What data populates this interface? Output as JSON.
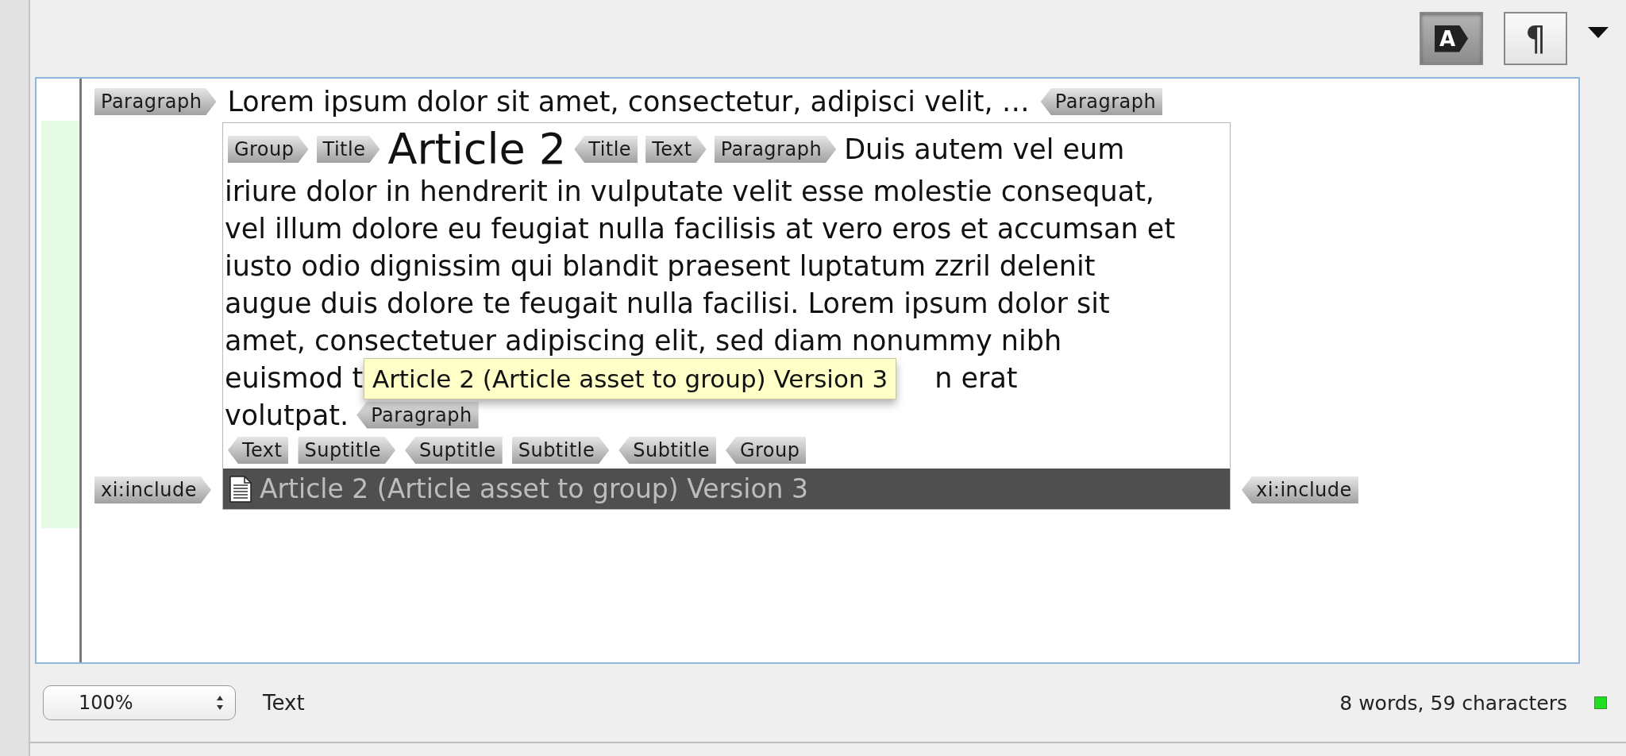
{
  "toolbar": [
    {
      "kind": "tags",
      "label": "A",
      "selected": true
    },
    {
      "kind": "pilcrow",
      "label": "¶",
      "selected": false
    }
  ],
  "editor": {
    "first_row": [
      {
        "kind": "tag-start",
        "text": "Paragraph"
      },
      {
        "kind": "text",
        "text": "Lorem ipsum dolor sit amet, consectetur, adipisci velit, …"
      },
      {
        "kind": "tag-end",
        "text": "Paragraph"
      }
    ],
    "include_start": {
      "kind": "tag-start",
      "text": "xi:include"
    },
    "article_lines": [
      [
        {
          "kind": "tag-start",
          "text": "Group"
        },
        {
          "kind": "tag-start",
          "text": "Title"
        },
        {
          "kind": "title",
          "text": "Article 2"
        },
        {
          "kind": "tag-end",
          "text": "Title"
        },
        {
          "kind": "tag-start",
          "text": "Text"
        },
        {
          "kind": "tag-start",
          "text": "Paragraph"
        },
        {
          "kind": "text",
          "text": "Duis autem vel eum"
        }
      ],
      [
        {
          "kind": "text",
          "text": "iriure dolor in hendrerit in vulputate velit esse molestie consequat,"
        }
      ],
      [
        {
          "kind": "text",
          "text": "vel illum dolore eu feugiat nulla facilisis at vero eros et accumsan et"
        }
      ],
      [
        {
          "kind": "text",
          "text": "iusto odio dignissim qui blandit praesent luptatum zzril delenit"
        }
      ],
      [
        {
          "kind": "text",
          "text": "augue duis dolore te feugait nulla facilisi. Lorem ipsum dolor sit"
        }
      ],
      [
        {
          "kind": "text",
          "text": "amet, consectetuer adipiscing elit, sed diam nonummy nibh"
        }
      ],
      [
        {
          "kind": "text",
          "text": "euismod t"
        },
        {
          "kind": "covered"
        },
        {
          "kind": "text",
          "text": "n erat"
        }
      ],
      [
        {
          "kind": "text",
          "text": "volutpat."
        },
        {
          "kind": "tag-end",
          "text": "Paragraph"
        }
      ],
      [
        {
          "kind": "tag-end",
          "text": "Text"
        },
        {
          "kind": "tag-start",
          "text": "Suptitle"
        },
        {
          "kind": "tag-end",
          "text": "Suptitle"
        },
        {
          "kind": "tag-start",
          "text": "Subtitle"
        },
        {
          "kind": "tag-end",
          "text": "Subtitle"
        },
        {
          "kind": "tag-end",
          "text": "Group"
        }
      ]
    ],
    "tooltip": "Article 2 (Article asset to group) Version 3",
    "include_bar": "Article 2 (Article asset to group) Version 3",
    "include_end": {
      "kind": "tag-end",
      "text": "xi:include"
    }
  },
  "status_bar": {
    "zoom": "100%",
    "context": "Text",
    "counts": "8 words, 59 characters"
  }
}
